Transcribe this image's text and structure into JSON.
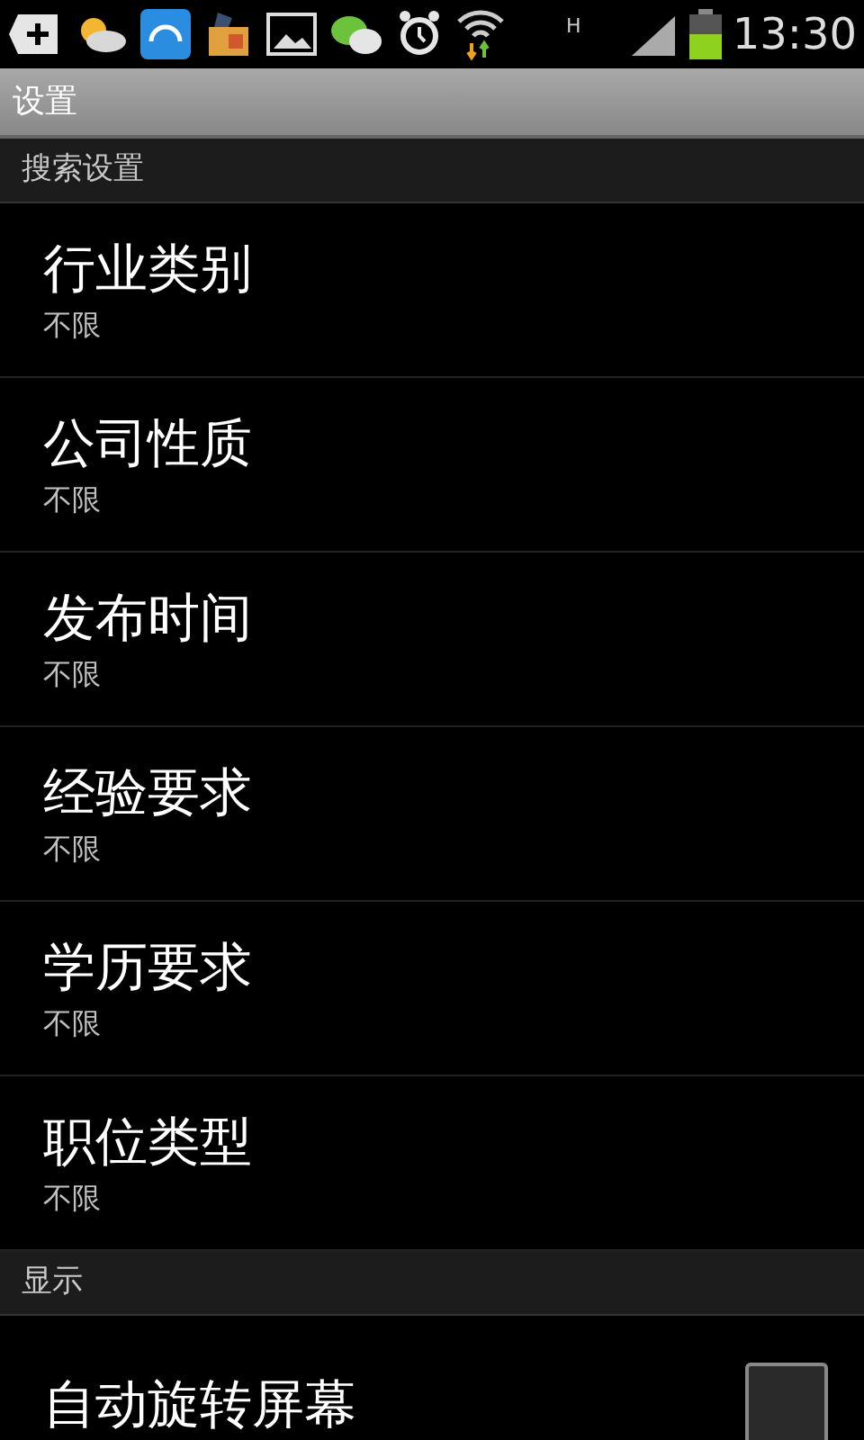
{
  "status_bar": {
    "network": "H",
    "time": "13:30"
  },
  "title_bar": {
    "title": "设置"
  },
  "sections": [
    {
      "header": "搜索设置",
      "items": [
        {
          "kind": "option",
          "title": "行业类别",
          "summary": "不限"
        },
        {
          "kind": "option",
          "title": "公司性质",
          "summary": "不限"
        },
        {
          "kind": "option",
          "title": "发布时间",
          "summary": "不限"
        },
        {
          "kind": "option",
          "title": "经验要求",
          "summary": "不限"
        },
        {
          "kind": "option",
          "title": "学历要求",
          "summary": "不限"
        },
        {
          "kind": "option",
          "title": "职位类型",
          "summary": "不限"
        }
      ]
    },
    {
      "header": "显示",
      "items": [
        {
          "kind": "checkbox",
          "title": "自动旋转屏幕",
          "checked": false
        }
      ]
    }
  ]
}
